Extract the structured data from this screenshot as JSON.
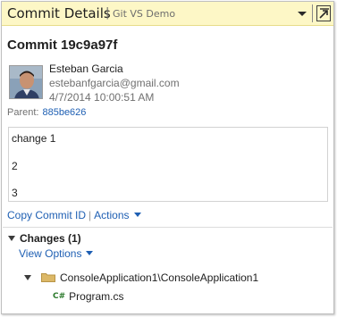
{
  "header": {
    "title": "Commit Details",
    "separator": "|",
    "subtitle": "Git VS Demo",
    "dropdown_icon": "chevron-down-icon",
    "popout_icon": "popout-icon",
    "bg_color": "#fdf7c6"
  },
  "commit": {
    "heading": "Commit 19c9a97f",
    "author_name": "Esteban Garcia",
    "author_email": "estebanfgarcia@gmail.com",
    "date": "4/7/2014 10:00:51 AM",
    "parent_label": "Parent:",
    "parent_hash": "885be626",
    "message_lines": [
      "change 1",
      "2",
      "3"
    ]
  },
  "actions": {
    "copy_commit_id": "Copy Commit ID",
    "separator": "|",
    "actions_label": "Actions"
  },
  "changes": {
    "header": "Changes (1)",
    "view_options": "View Options",
    "tree": {
      "folder": "ConsoleApplication1\\ConsoleApplication1",
      "files": [
        "Program.cs"
      ]
    }
  },
  "colors": {
    "link": "#1e5fb3",
    "muted": "#707070",
    "cs_icon": "#2b7a2b"
  }
}
